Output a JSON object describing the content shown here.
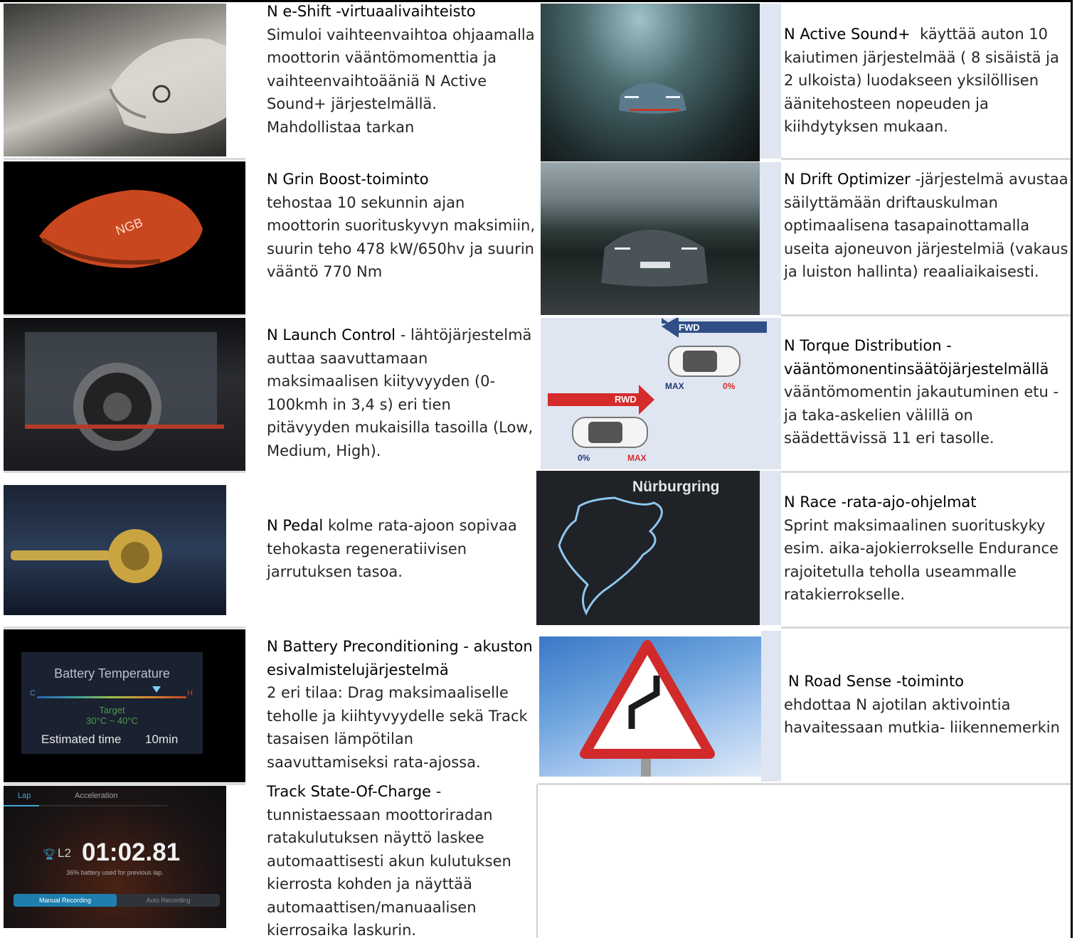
{
  "rows": [
    {
      "left": {
        "heading": "N e-Shift -virtuaalivaihteisto",
        "body": "Simuloi vaihteenvaihtoa ohjaamalla moottorin vääntömomenttia ja vaihteenvaihtoääniä N Active Sound+ järjestelmällä. Mahdollistaa tarkan"
      },
      "right": {
        "heading": "N Active Sound+",
        "body": "käyttää auton 10 kaiutimen järjestelmää ( 8 sisäistä ja 2 ulkoista) luodakseen yksilöllisen äänitehosteen nopeuden ja kiihdytyksen mukaan."
      }
    },
    {
      "left": {
        "heading": "N Grin Boost-toiminto",
        "body": "tehostaa 10 sekunnin ajan moottorin suorituskyvyn maksimiin,  suurin teho 478 kW/650hv ja suurin vääntö 770 Nm"
      },
      "right": {
        "heading": "N Drift Optimizer",
        "body": "-järjestelmä avustaa säilyttämään driftauskulman optimaalisena tasapainottamalla useita ajoneuvon järjestelmiä  (vakaus ja luiston hallinta) reaaliaikaisesti."
      }
    },
    {
      "left": {
        "heading": "N Launch Control",
        "body": "- lähtöjärjestelmä auttaa saavuttamaan maksimaalisen kiityvyyden (0-100kmh in 3,4 s) eri tien pitävyyden mukaisilla tasoilla (Low, Medium, High)."
      },
      "right": {
        "heading": "N Torque Distribution - vääntömonentinsäätöjärjestelmällä",
        "body": "vääntömomentin jakautuminen etu - ja taka-askelien välillä on säädettävissä 11 eri tasolle."
      }
    },
    {
      "left": {
        "heading": "N Pedal",
        "body": "kolme rata-ajoon sopivaa tehokasta regeneratiivisen jarrutuksen tasoa."
      },
      "right": {
        "heading": "N Race -rata-ajo-ohjelmat",
        "body": "Sprint maksimaalinen suorituskyky esim. aika-ajokierrokselle Endurance rajoitetulla teholla useammalle ratakierrokselle."
      }
    },
    {
      "left": {
        "heading": "N Battery Preconditioning  - akuston esivalmistelujärjestelmä",
        "body": "2 eri tilaa: Drag maksimaaliselle teholle ja kiihtyvyydelle sekä Track tasaisen lämpötilan saavuttamiseksi rata-ajossa."
      },
      "right": {
        "heading": "N Road Sense -toiminto",
        "body": "ehdottaa N ajotilan aktivointia havaitessaan mutkia- liikennemerkin"
      }
    },
    {
      "left": {
        "heading": "Track State-Of-Charge",
        "body": "- tunnistaessaan moottoriradan ratakulutuksen näyttö laskee automaattisesti akun kulutuksen kierrosta kohden ja näyttää automaattisen/manuaalisen kierrosaika laskurin."
      }
    }
  ],
  "images": {
    "torque": {
      "fwd": "FWD",
      "rwd": "RWD",
      "max_top": "MAX",
      "pct_top": "0%",
      "pct_bottom": "0%",
      "max_bottom": "MAX",
      "colors": {
        "fwd": "#2f4f86",
        "rwd": "#d62b2b",
        "bg": "#dfe6f2"
      }
    },
    "nurburgring": {
      "label": "Nürburgring"
    },
    "battery": {
      "title": "Battery Temperature",
      "target_label": "Target",
      "target_range": "30°C ~ 40°C",
      "estimated": "Estimated time",
      "minutes": "10min",
      "c": "C",
      "h": "H"
    },
    "lap": {
      "tab_lap": "Lap",
      "tab_acc": "Acceleration",
      "lap_no": "L2",
      "time": "01:02.81",
      "note": "36% battery used for previous lap.",
      "btn_manual": "Manual Recording",
      "btn_auto": "Auto Recording"
    },
    "grin_button": {
      "label": "NGB"
    }
  }
}
